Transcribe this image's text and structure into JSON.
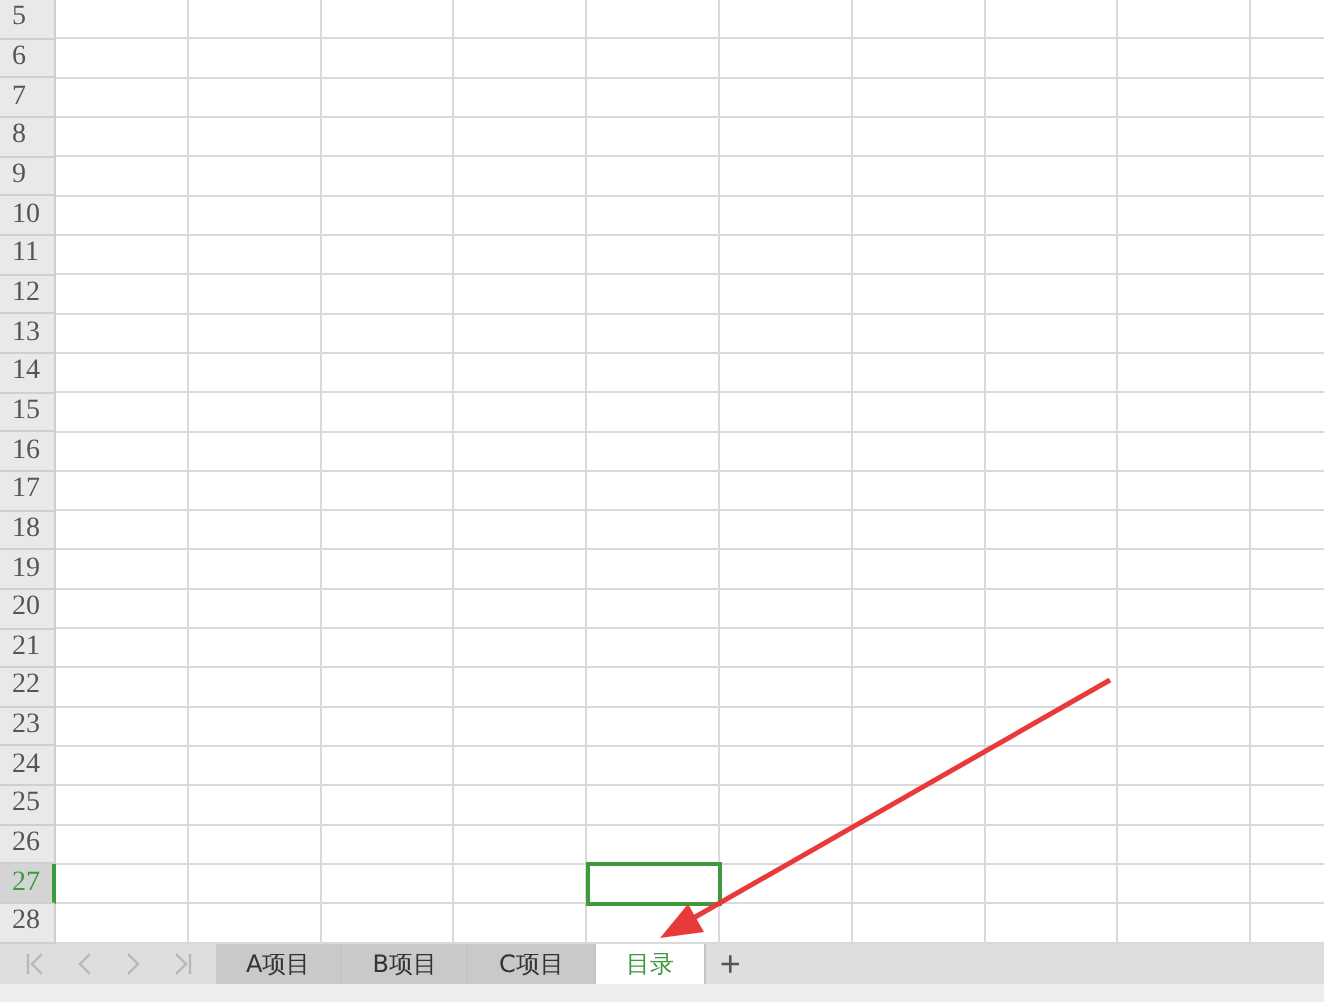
{
  "rows": [
    {
      "header": "5",
      "selected": false,
      "cells": [
        false,
        false,
        false,
        false,
        false,
        false,
        false,
        false,
        false,
        false
      ]
    },
    {
      "header": "6",
      "selected": false,
      "cells": [
        false,
        false,
        false,
        false,
        false,
        false,
        false,
        false,
        false,
        false
      ]
    },
    {
      "header": "7",
      "selected": false,
      "cells": [
        false,
        false,
        false,
        false,
        false,
        false,
        false,
        false,
        false,
        false
      ]
    },
    {
      "header": "8",
      "selected": false,
      "cells": [
        false,
        false,
        false,
        false,
        false,
        false,
        false,
        false,
        false,
        false
      ]
    },
    {
      "header": "9",
      "selected": false,
      "cells": [
        false,
        false,
        false,
        false,
        false,
        false,
        false,
        false,
        false,
        false
      ]
    },
    {
      "header": "10",
      "selected": false,
      "cells": [
        false,
        false,
        false,
        false,
        false,
        false,
        false,
        false,
        false,
        false
      ]
    },
    {
      "header": "11",
      "selected": false,
      "cells": [
        false,
        false,
        false,
        false,
        false,
        false,
        false,
        false,
        false,
        false
      ]
    },
    {
      "header": "12",
      "selected": false,
      "cells": [
        false,
        false,
        false,
        false,
        false,
        false,
        false,
        false,
        false,
        false
      ]
    },
    {
      "header": "13",
      "selected": false,
      "cells": [
        false,
        false,
        false,
        false,
        false,
        false,
        false,
        false,
        false,
        false
      ]
    },
    {
      "header": "14",
      "selected": false,
      "cells": [
        false,
        false,
        false,
        false,
        false,
        false,
        false,
        false,
        false,
        false
      ]
    },
    {
      "header": "15",
      "selected": false,
      "cells": [
        false,
        false,
        false,
        false,
        false,
        false,
        false,
        false,
        false,
        false
      ]
    },
    {
      "header": "16",
      "selected": false,
      "cells": [
        false,
        false,
        false,
        false,
        false,
        false,
        false,
        false,
        false,
        false
      ]
    },
    {
      "header": "17",
      "selected": false,
      "cells": [
        false,
        false,
        false,
        false,
        false,
        false,
        false,
        false,
        false,
        false
      ]
    },
    {
      "header": "18",
      "selected": false,
      "cells": [
        false,
        false,
        false,
        false,
        false,
        false,
        false,
        false,
        false,
        false
      ]
    },
    {
      "header": "19",
      "selected": false,
      "cells": [
        false,
        false,
        false,
        false,
        false,
        false,
        false,
        false,
        false,
        false
      ]
    },
    {
      "header": "20",
      "selected": false,
      "cells": [
        false,
        false,
        false,
        false,
        false,
        false,
        false,
        false,
        false,
        false
      ]
    },
    {
      "header": "21",
      "selected": false,
      "cells": [
        false,
        false,
        false,
        false,
        false,
        false,
        false,
        false,
        false,
        false
      ]
    },
    {
      "header": "22",
      "selected": false,
      "cells": [
        false,
        false,
        false,
        false,
        false,
        false,
        false,
        false,
        false,
        false
      ]
    },
    {
      "header": "23",
      "selected": false,
      "cells": [
        false,
        false,
        false,
        false,
        false,
        false,
        false,
        false,
        false,
        false
      ]
    },
    {
      "header": "24",
      "selected": false,
      "cells": [
        false,
        false,
        false,
        false,
        false,
        false,
        false,
        false,
        false,
        false
      ]
    },
    {
      "header": "25",
      "selected": false,
      "cells": [
        false,
        false,
        false,
        false,
        false,
        false,
        false,
        false,
        false,
        false
      ]
    },
    {
      "header": "26",
      "selected": false,
      "cells": [
        false,
        false,
        false,
        false,
        false,
        false,
        false,
        false,
        false,
        false
      ]
    },
    {
      "header": "27",
      "selected": true,
      "cells": [
        false,
        false,
        false,
        false,
        true,
        false,
        false,
        false,
        false,
        false
      ]
    },
    {
      "header": "28",
      "selected": false,
      "cells": [
        false,
        false,
        false,
        false,
        false,
        false,
        false,
        false,
        false,
        false
      ]
    }
  ],
  "sheet_tabs": [
    {
      "label": "A项目",
      "selected": false
    },
    {
      "label": "B项目",
      "selected": false
    },
    {
      "label": "C项目",
      "selected": false
    },
    {
      "label": "目录",
      "selected": true
    }
  ],
  "add_sheet": "+"
}
